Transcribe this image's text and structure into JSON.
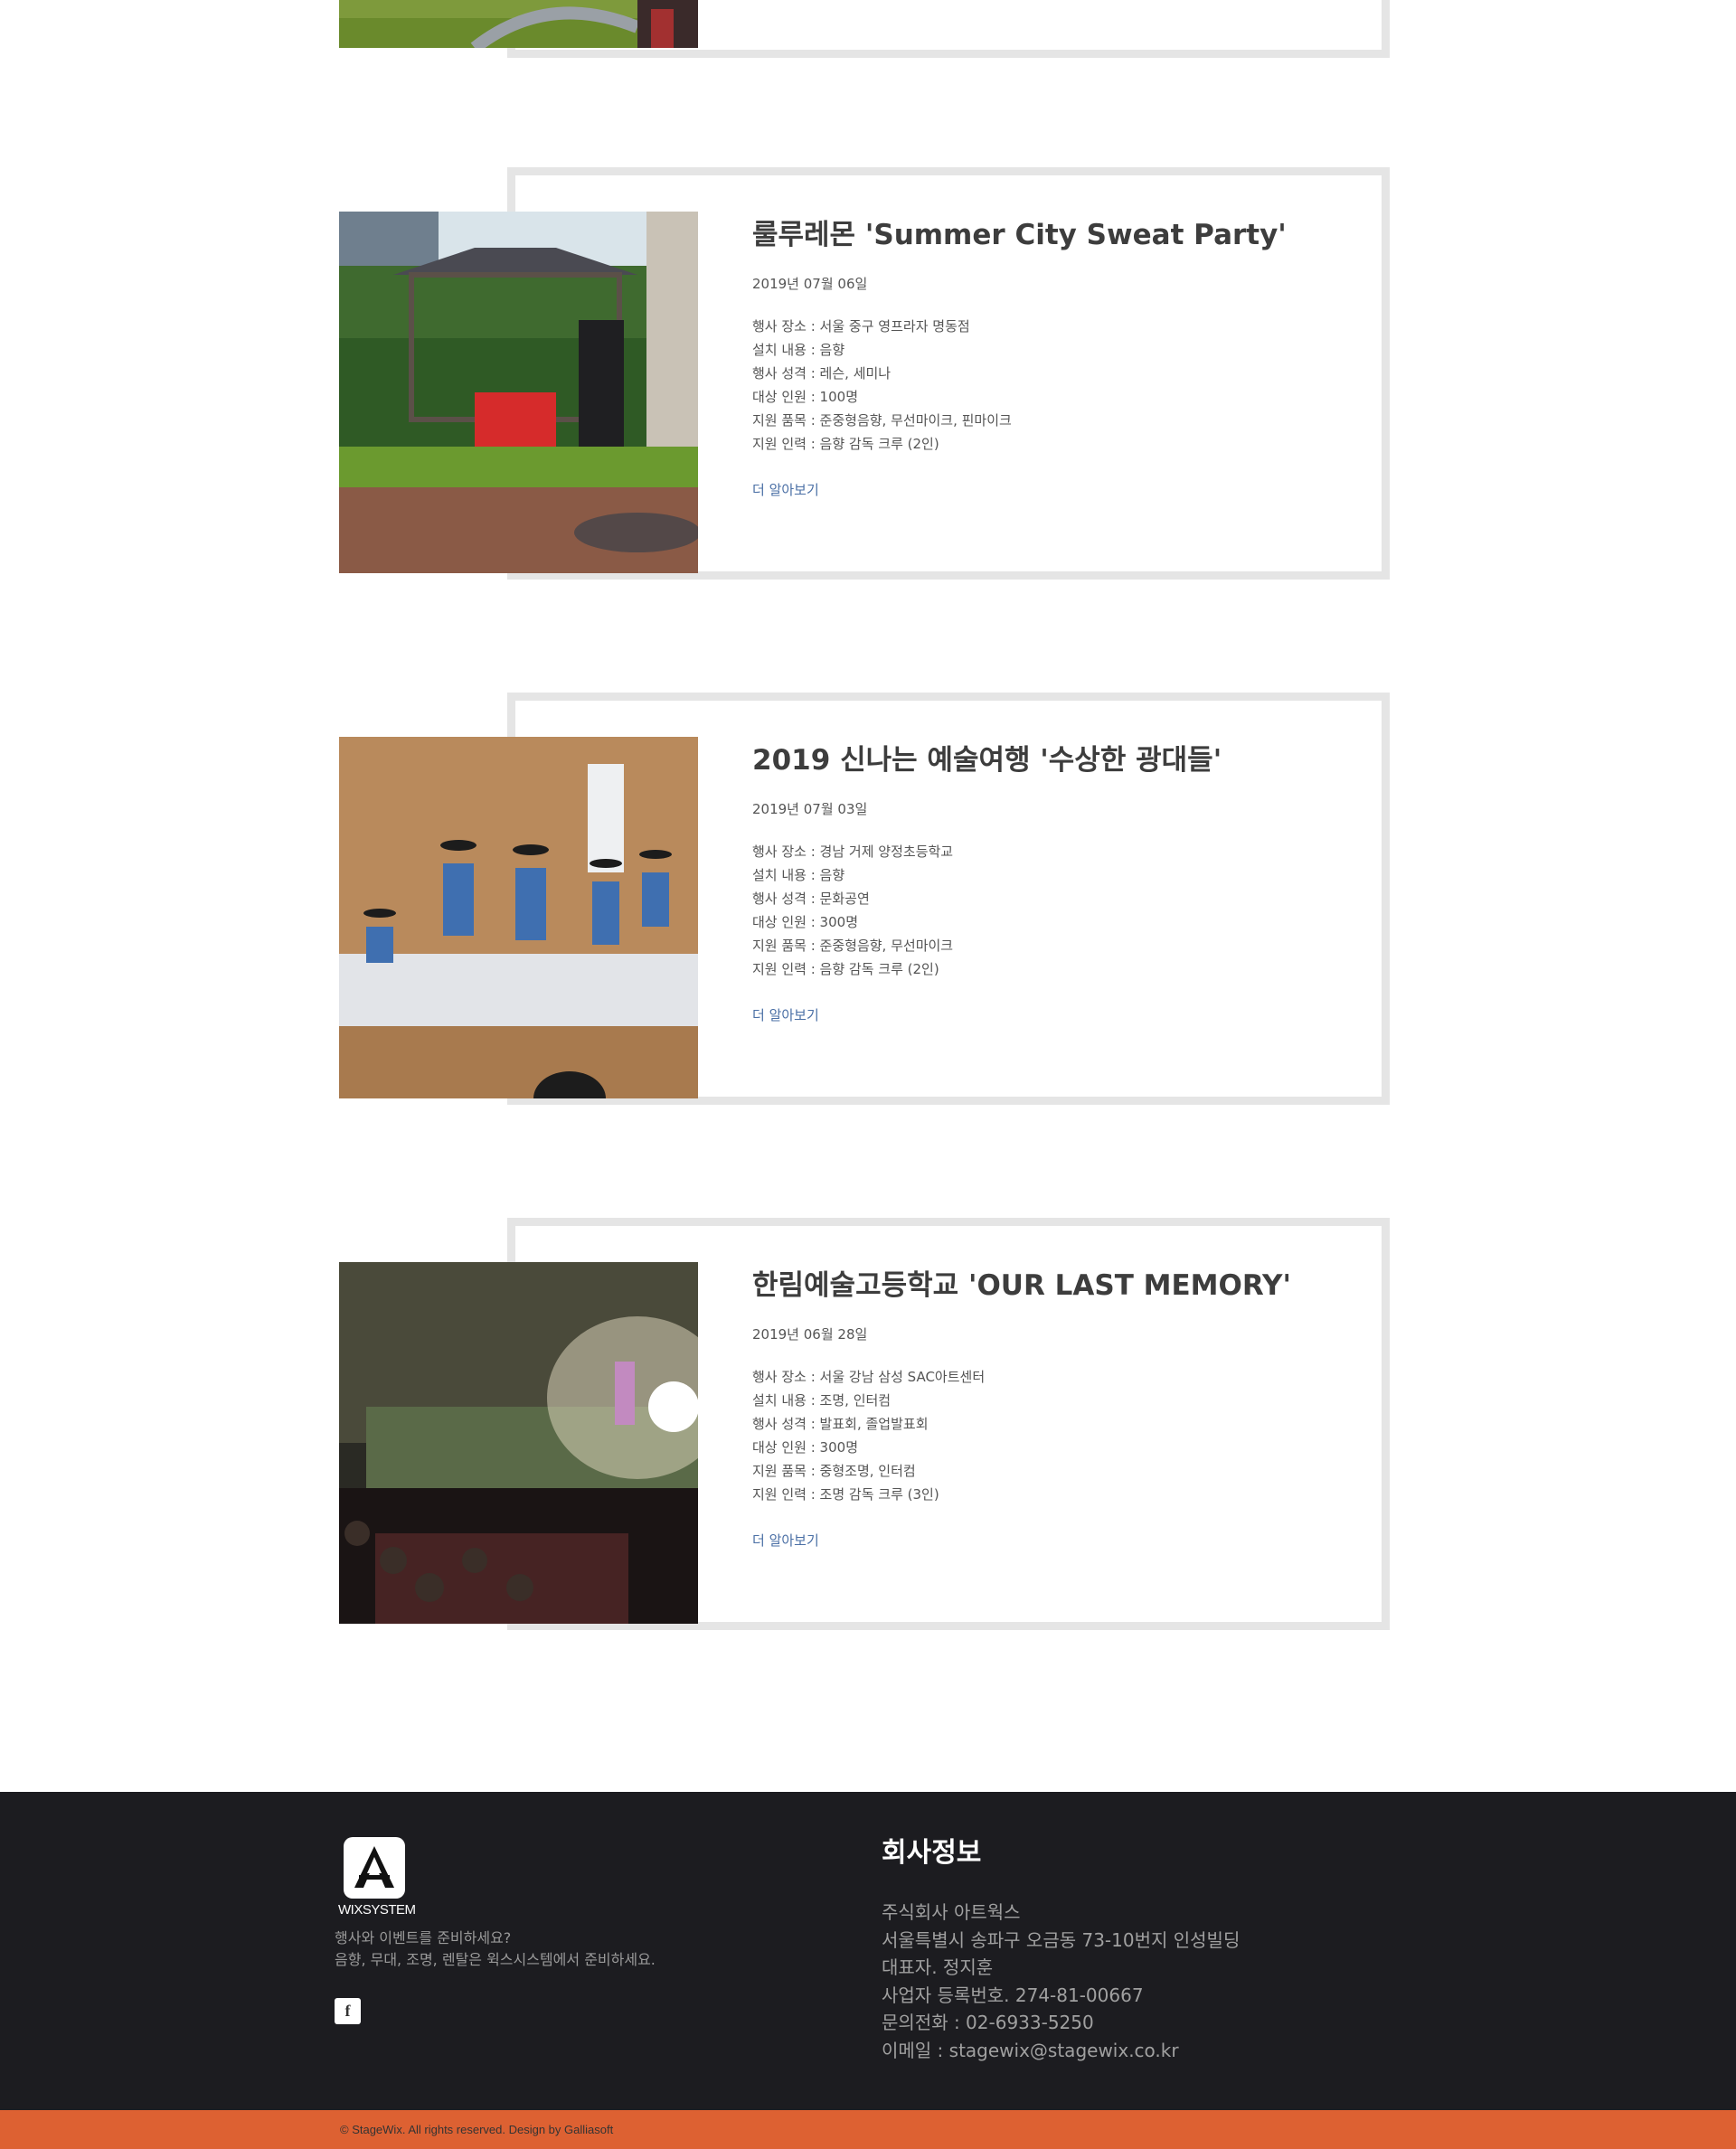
{
  "events": [
    {
      "title": "룰루레몬 'Summer City Sweat Party'",
      "date": "2019년 07월 06일",
      "details": [
        "행사 장소 : 서울 중구 영프라자 명동점",
        "설치 내용 : 음향",
        "행사 성격 : 레슨, 세미나",
        "대상 인원 : 100명",
        "지원 품목 : 준중형음향, 무선마이크, 핀마이크",
        "지원 인력 : 음향 감독 크루 (2인)"
      ],
      "more_label": "더 알아보기"
    },
    {
      "title": "2019 신나는 예술여행 '수상한 광대들'",
      "date": "2019년 07월 03일",
      "details": [
        "행사 장소 : 경남 거제 양정초등학교",
        "설치 내용 : 음향",
        "행사 성격 : 문화공연",
        "대상 인원 : 300명",
        "지원 품목 : 준중형음향, 무선마이크",
        "지원 인력 : 음향 감독 크루 (2인)"
      ],
      "more_label": "더 알아보기"
    },
    {
      "title": "한림예술고등학교 'OUR LAST MEMORY'",
      "date": "2019년 06월 28일",
      "details": [
        "행사 장소 : 서울 강남 삼성 SAC아트센터",
        "설치 내용 : 조명, 인터컴",
        "행사 성격 : 발표회, 졸업발표회",
        "대상 인원 : 300명",
        "지원 품목 : 중형조명, 인터컴",
        "지원 인력 : 조명 감독 크루 (3인)"
      ],
      "more_label": "더 알아보기"
    }
  ],
  "footer": {
    "logo_text": "WIXSYSTEM",
    "tagline_line1": "행사와 이벤트를 준비하세요?",
    "tagline_line2": "음향, 무대, 조명, 렌탈은 윅스시스템에서 준비하세요.",
    "social_icon": "facebook-icon",
    "social_label": "f",
    "company_heading": "회사정보",
    "company_lines": [
      "주식회사 아트웍스",
      "서울특별시 송파구 오금동 73-10번지 인성빌딩",
      "대표자. 정지훈",
      "사업자 등록번호. 274-81-00667",
      "문의전화 : 02-6933-5250",
      "이메일 : stagewix@stagewix.co.kr"
    ],
    "copyright": "© StageWix. All rights reserved. Design by Galliasoft"
  },
  "colors": {
    "footer_bg": "#1c1c20",
    "copyright_bg": "#dd6132",
    "link": "#4a6fa5",
    "frame": "#e5e5e5"
  }
}
